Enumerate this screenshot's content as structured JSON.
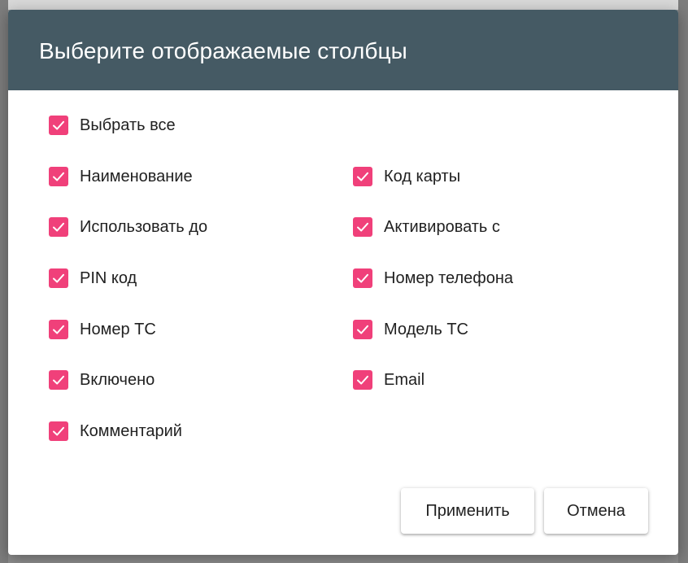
{
  "dialog": {
    "title": "Выберите отображаемые столбцы",
    "accent_color": "#f0407a",
    "header_color": "#455a64",
    "select_all": {
      "label": "Выбрать все",
      "checked": true
    },
    "left_column": [
      {
        "label": "Наименование",
        "checked": true
      },
      {
        "label": "Использовать до",
        "checked": true
      },
      {
        "label": "PIN код",
        "checked": true
      },
      {
        "label": "Номер ТС",
        "checked": true
      },
      {
        "label": "Включено",
        "checked": true
      },
      {
        "label": "Комментарий",
        "checked": true
      }
    ],
    "right_column": [
      {
        "label": "Код карты",
        "checked": true
      },
      {
        "label": "Активировать с",
        "checked": true
      },
      {
        "label": "Номер телефона",
        "checked": true
      },
      {
        "label": "Модель ТС",
        "checked": true
      },
      {
        "label": "Email",
        "checked": true
      }
    ],
    "buttons": {
      "apply": "Применить",
      "cancel": "Отмена"
    }
  }
}
